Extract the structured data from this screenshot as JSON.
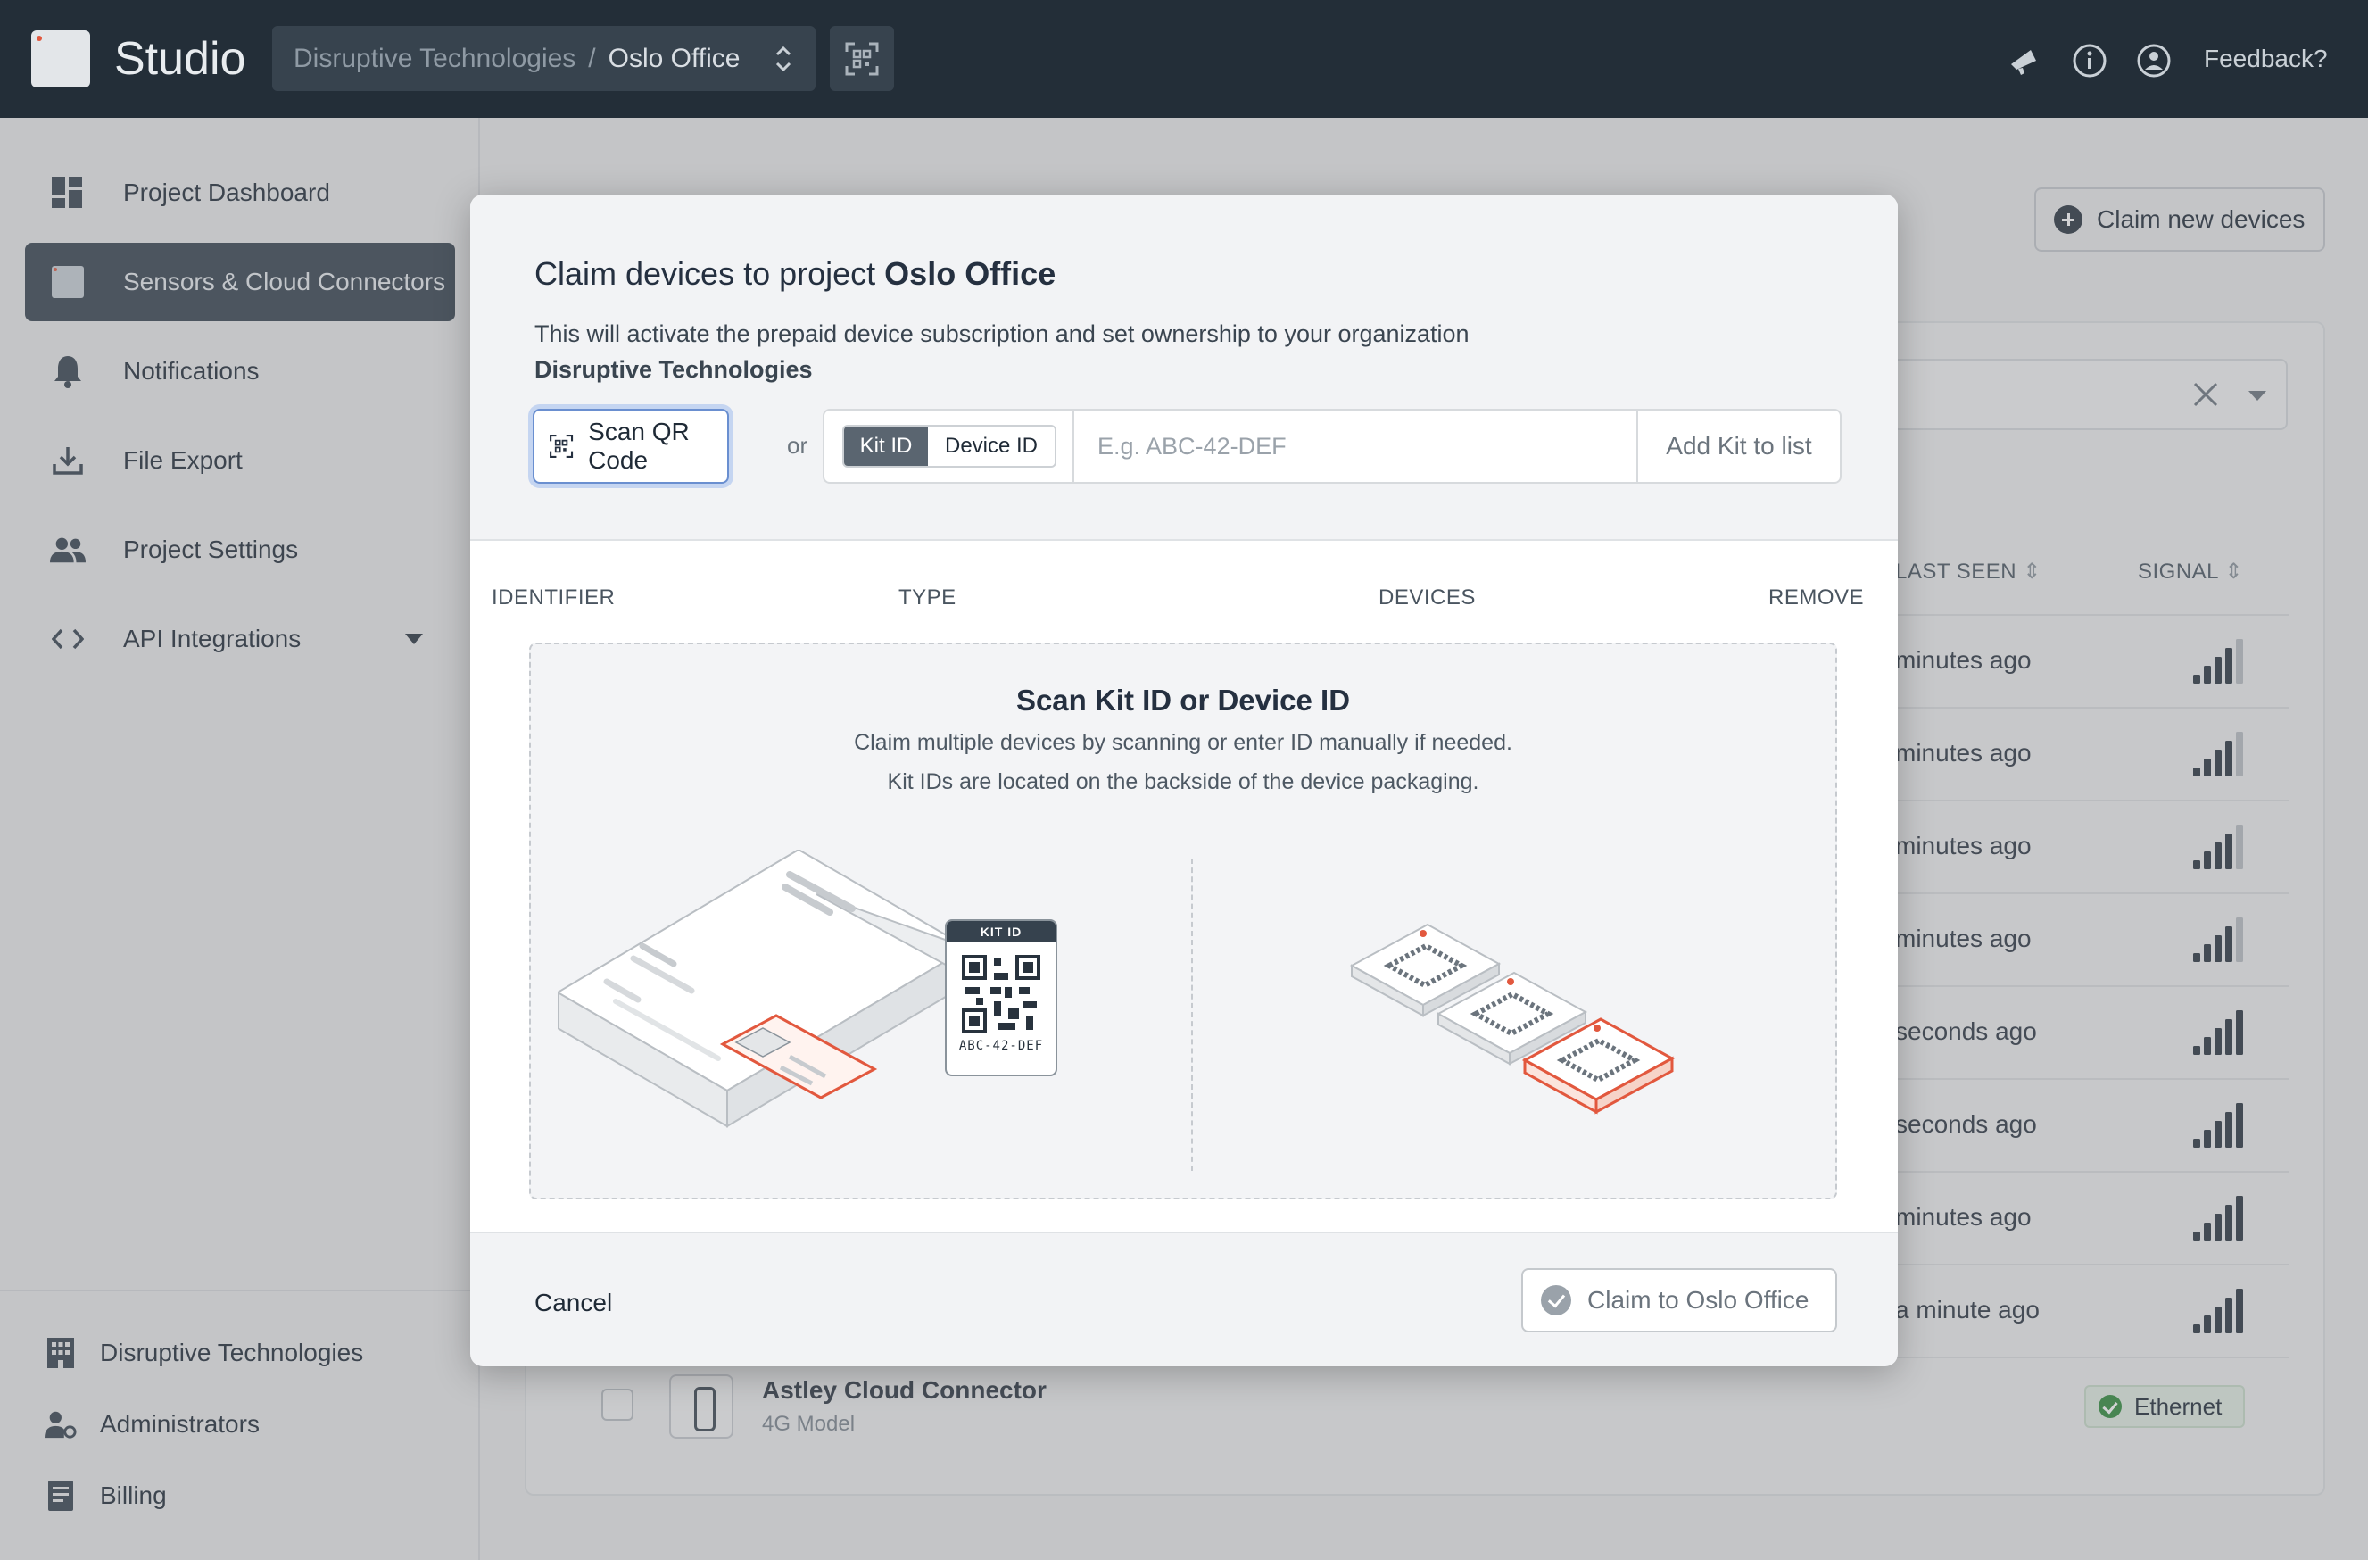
{
  "app": {
    "name": "Studio"
  },
  "header": {
    "org": "Disruptive Technologies",
    "separator": "/",
    "project": "Oslo Office",
    "feedback": "Feedback?"
  },
  "sidebar": {
    "items": [
      {
        "label": "Project Dashboard",
        "icon": "dashboard-icon"
      },
      {
        "label": "Sensors & Cloud Connectors",
        "icon": "sensor-icon",
        "active": true
      },
      {
        "label": "Notifications",
        "icon": "bell-icon"
      },
      {
        "label": "File Export",
        "icon": "download-icon"
      },
      {
        "label": "Project Settings",
        "icon": "people-icon"
      },
      {
        "label": "API Integrations",
        "icon": "code-icon"
      }
    ],
    "org_items": [
      {
        "label": "Disruptive Technologies",
        "icon": "building-icon"
      },
      {
        "label": "Administrators",
        "icon": "admin-icon"
      },
      {
        "label": "Billing",
        "icon": "billing-icon"
      }
    ]
  },
  "background": {
    "claim_new_label": "Claim new devices",
    "columns": {
      "last_seen": "LAST SEEN",
      "signal": "SIGNAL"
    },
    "rows": [
      {
        "last_seen": "minutes ago",
        "signal_level": 4
      },
      {
        "last_seen": "minutes ago",
        "signal_level": 4
      },
      {
        "last_seen": "minutes ago",
        "signal_level": 4
      },
      {
        "last_seen": "minutes ago",
        "signal_level": 4
      },
      {
        "last_seen": "seconds ago",
        "signal_level": 5
      },
      {
        "last_seen": "seconds ago",
        "signal_level": 5
      },
      {
        "last_seen": "minutes ago",
        "signal_level": 5
      },
      {
        "last_seen": "a minute ago",
        "signal_level": 5
      }
    ],
    "last_device": {
      "name": "Astley Cloud Connector",
      "model": "4G Model",
      "connection": "Ethernet"
    }
  },
  "modal": {
    "title_prefix": "Claim devices to project",
    "title_project": "Oslo Office",
    "description": "This will activate the prepaid device subscription and set ownership to your organization",
    "org": "Disruptive Technologies",
    "scan_label": "Scan QR Code",
    "or_label": "or",
    "kit_id_label": "Kit ID",
    "device_id_label": "Device ID",
    "input_placeholder": "E.g. ABC-42-DEF",
    "add_label": "Add Kit to list",
    "columns": {
      "identifier": "IDENTIFIER",
      "type": "TYPE",
      "devices": "DEVICES",
      "remove": "REMOVE"
    },
    "drop_title": "Scan Kit ID or Device ID",
    "drop_line1": "Claim multiple devices by scanning or enter ID manually if needed.",
    "drop_line2": "Kit IDs are located on the backside of the device packaging.",
    "kit_tag_title": "KIT ID",
    "kit_tag_code": "ABC-42-DEF",
    "cancel_label": "Cancel",
    "claim_label": "Claim to Oslo Office"
  },
  "colors": {
    "topbar": "#232e38",
    "active_nav": "#36424e",
    "accent_orange": "#e2583e"
  }
}
